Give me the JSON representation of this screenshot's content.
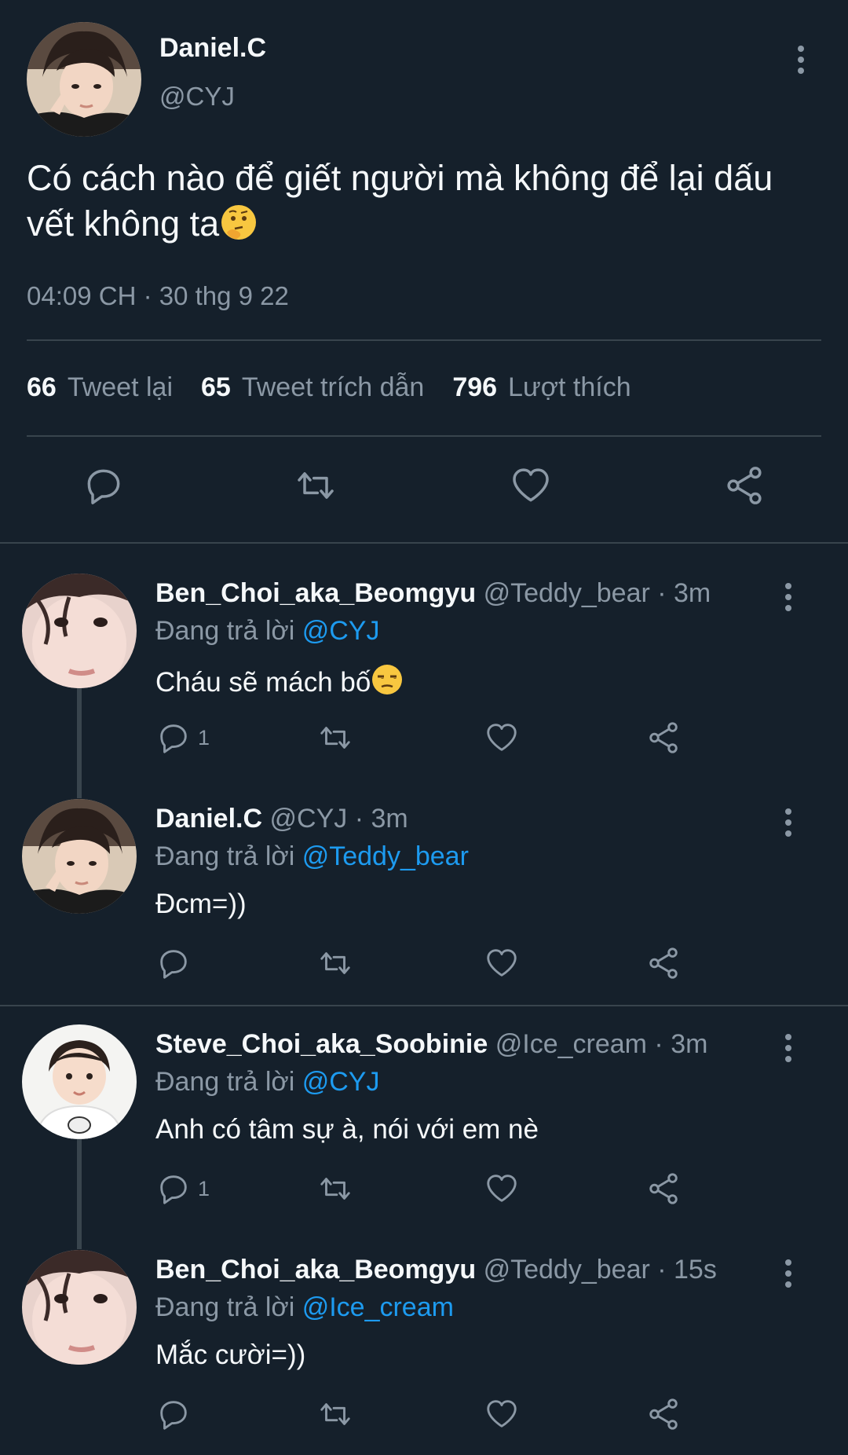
{
  "main_tweet": {
    "author_name": "Daniel.C",
    "author_handle": "@CYJ",
    "text": "Có cách nào để giết người mà không để lại dấu vết không ta",
    "emoji_icon": "thinking-face-icon",
    "timestamp": "04:09 CH · 30 thg 9 22",
    "stats": {
      "retweets_count": "66",
      "retweets_label": "Tweet lại",
      "quotes_count": "65",
      "quotes_label": "Tweet trích dẫn",
      "likes_count": "796",
      "likes_label": "Lượt thích"
    }
  },
  "replies": [
    {
      "name": "Ben_Choi_aka_Beomgyu",
      "handle": "@Teddy_bear",
      "time": " · 3m",
      "replying_prefix": "Đang trả lời ",
      "replying_to": "@CYJ",
      "text": "Cháu sẽ mách bố",
      "emoji_icon": "unamused-face-icon",
      "reply_count": "1"
    },
    {
      "name": "Daniel.C",
      "handle": "@CYJ",
      "time": " · 3m",
      "replying_prefix": "Đang trả lời ",
      "replying_to": "@Teddy_bear",
      "text": "Đcm=))",
      "reply_count": ""
    },
    {
      "name": "Steve_Choi_aka_Soobinie",
      "handle": "@Ice_cream",
      "time": " · 3m",
      "replying_prefix": "Đang trả lời ",
      "replying_to": "@CYJ",
      "text": "Anh có tâm sự à, nói với em nè",
      "reply_count": "1"
    },
    {
      "name": "Ben_Choi_aka_Beomgyu",
      "handle": "@Teddy_bear",
      "time": " · 15s",
      "replying_prefix": "Đang trả lời ",
      "replying_to": "@Ice_cream",
      "text": "Mắc cười=))",
      "reply_count": ""
    }
  ],
  "colors": {
    "background": "#15202b",
    "divider": "#38444d",
    "secondary_text": "#8b98a5",
    "link": "#1d9bf0"
  }
}
